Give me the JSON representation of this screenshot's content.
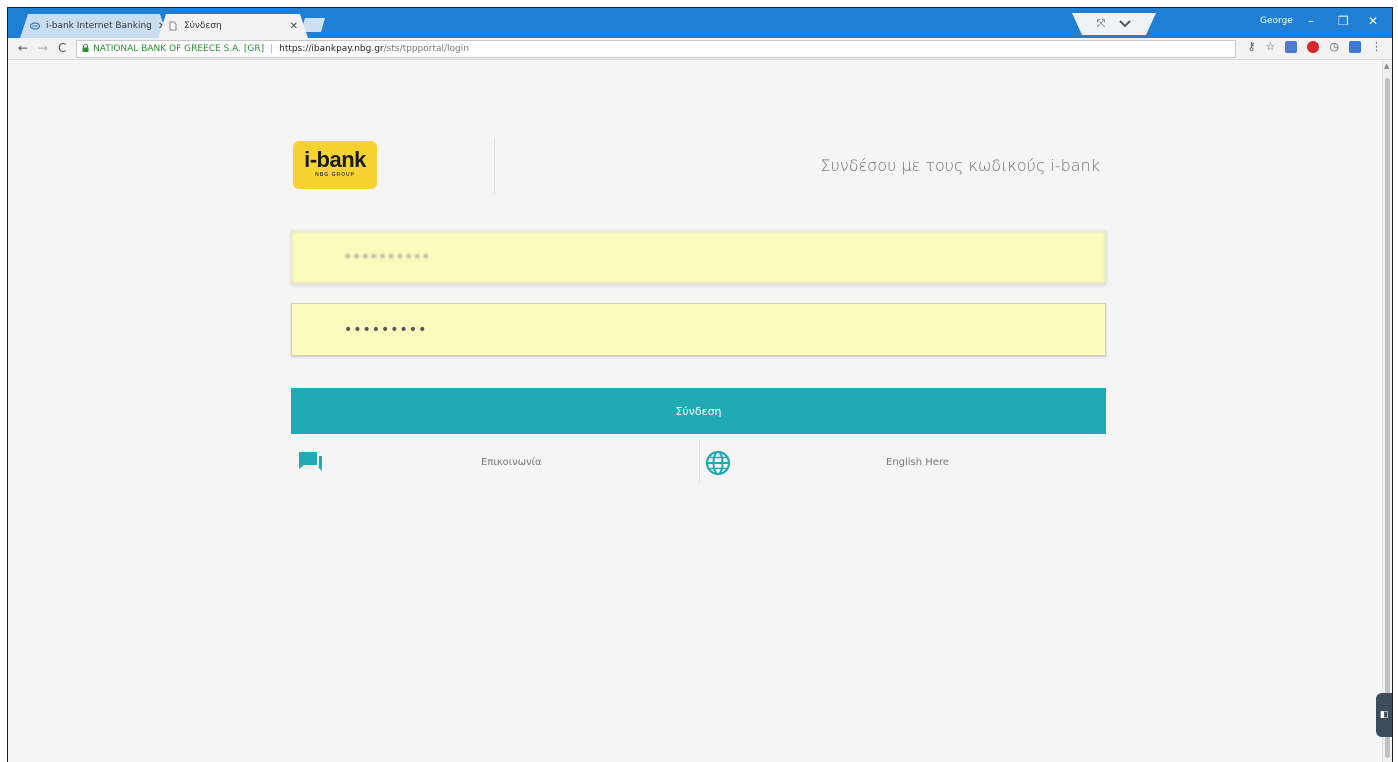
{
  "browser": {
    "tabs": [
      {
        "label": "i-bank Internet Banking",
        "active": false
      },
      {
        "label": "Σύνδεση",
        "active": true
      }
    ],
    "profile_name": "George",
    "address_bar": {
      "site_name": "NATIONAL BANK OF GREECE S.A. [GR]",
      "separator": "|",
      "url_host": "https://ibankpay.nbg.gr",
      "url_path": "/sts/tppportal/login"
    }
  },
  "page": {
    "logo": {
      "text": "i-bank",
      "subtext": "NBG GROUP"
    },
    "heading": "Συνδέσου με τους κωδικούς i-bank",
    "username_value": "••••••••••",
    "password_value": "•••••••••",
    "login_button_label": "Σύνδεση",
    "contact_label": "Επικοινωνία",
    "language_label": "English Here"
  },
  "colors": {
    "accent": "#21a9b5",
    "field_background": "#fafbbd",
    "logo_yellow": "#f7d331",
    "titlebar_blue": "#1e7fd4"
  },
  "icons": [
    "chat-icon",
    "globe-icon",
    "lock-icon",
    "star-icon",
    "key-icon",
    "menu-icon"
  ]
}
